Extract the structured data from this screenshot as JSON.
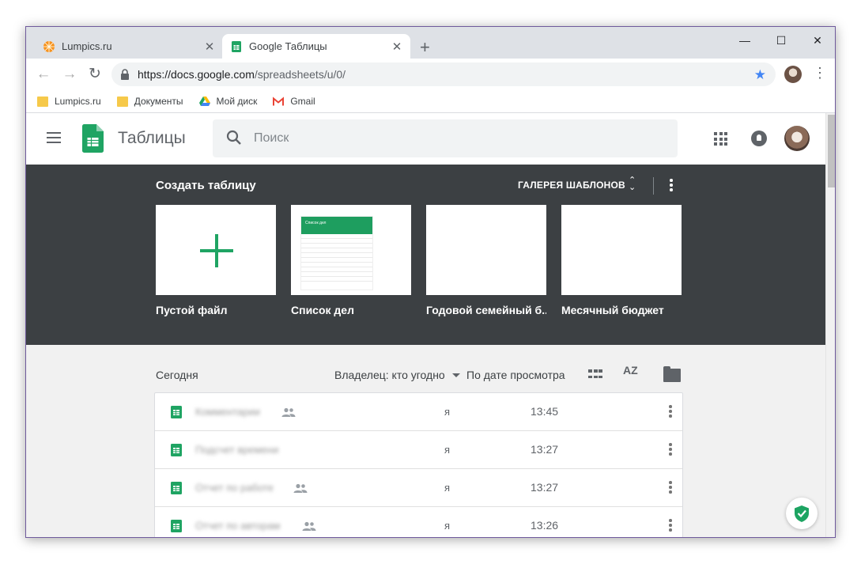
{
  "browser": {
    "tabs": [
      {
        "title": "Lumpics.ru",
        "icon": "lumpics-favicon",
        "active": false
      },
      {
        "title": "Google Таблицы",
        "icon": "sheets-favicon",
        "active": true
      }
    ],
    "new_tab": "+",
    "window_controls": {
      "minimize": "—",
      "maximize": "☐",
      "close": "✕"
    },
    "url_host": "https://docs.google.com",
    "url_path": "/spreadsheets/u/0/",
    "bookmarks": [
      {
        "label": "Lumpics.ru",
        "icon": "folder-icon"
      },
      {
        "label": "Документы",
        "icon": "folder-icon"
      },
      {
        "label": "Мой диск",
        "icon": "drive-icon"
      },
      {
        "label": "Gmail",
        "icon": "gmail-icon"
      }
    ]
  },
  "app": {
    "title": "Таблицы",
    "search_placeholder": "Поиск"
  },
  "templates": {
    "header": "Создать таблицу",
    "gallery_label": "ГАЛЕРЕЯ ШАБЛОНОВ",
    "items": [
      {
        "label": "Пустой файл"
      },
      {
        "label": "Список дел",
        "preview_title": "Список дел"
      },
      {
        "label": "Годовой семейный б..."
      },
      {
        "label": "Месячный бюджет"
      }
    ]
  },
  "files": {
    "section_label": "Сегодня",
    "owner_filter": "Владелец: кто угодно",
    "sort_label": "По дате просмотра",
    "sort_icon": "AZ",
    "rows": [
      {
        "name": "Комментарии",
        "shared": true,
        "owner": "я",
        "time": "13:45"
      },
      {
        "name": "Подсчет времени",
        "shared": false,
        "owner": "я",
        "time": "13:27"
      },
      {
        "name": "Отчет по работе",
        "shared": true,
        "owner": "я",
        "time": "13:27"
      },
      {
        "name": "Отчет по авторам",
        "shared": true,
        "owner": "я",
        "time": "13:26"
      }
    ]
  },
  "colors": {
    "sheets_green": "#1fa463",
    "template_bg": "#3c4043",
    "star_blue": "#4285f4",
    "shield_green": "#1da462"
  }
}
